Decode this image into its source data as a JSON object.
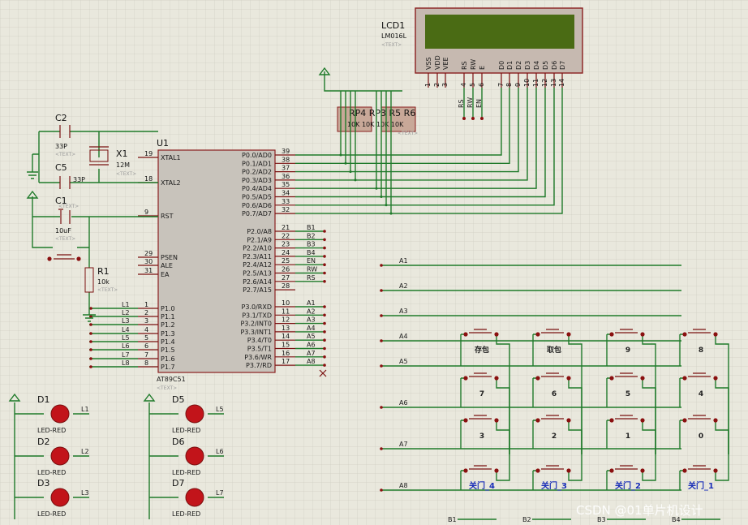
{
  "lcd": {
    "ref": "LCD1",
    "model": "LM016L",
    "text": "<TEXT>",
    "pins": [
      "VSS",
      "VDD",
      "VEE",
      "RS",
      "RW",
      "E",
      "D0",
      "D1",
      "D2",
      "D3",
      "D4",
      "D5",
      "D6",
      "D7"
    ],
    "nums": [
      "1",
      "2",
      "3",
      "4",
      "5",
      "6",
      "7",
      "8",
      "9",
      "10",
      "11",
      "12",
      "13",
      "14"
    ],
    "ctrl": [
      "RS",
      "RW",
      "EN"
    ]
  },
  "mcu": {
    "ref": "U1",
    "model": "AT89C51",
    "text": "<TEXT>",
    "left": [
      {
        "n": "19",
        "l": "XTAL1"
      },
      {
        "n": "18",
        "l": "XTAL2"
      },
      {
        "n": "9",
        "l": "RST"
      },
      {
        "n": "29",
        "l": "PSEN"
      },
      {
        "n": "30",
        "l": "ALE"
      },
      {
        "n": "31",
        "l": "EA"
      },
      {
        "n": "1",
        "l": "P1.0"
      },
      {
        "n": "2",
        "l": "P1.1"
      },
      {
        "n": "3",
        "l": "P1.2"
      },
      {
        "n": "4",
        "l": "P1.3"
      },
      {
        "n": "5",
        "l": "P1.4"
      },
      {
        "n": "6",
        "l": "P1.5"
      },
      {
        "n": "7",
        "l": "P1.6"
      },
      {
        "n": "8",
        "l": "P1.7"
      }
    ],
    "p0": [
      {
        "n": "39",
        "l": "P0.0/AD0"
      },
      {
        "n": "38",
        "l": "P0.1/AD1"
      },
      {
        "n": "37",
        "l": "P0.2/AD2"
      },
      {
        "n": "36",
        "l": "P0.3/AD3"
      },
      {
        "n": "35",
        "l": "P0.4/AD4"
      },
      {
        "n": "34",
        "l": "P0.5/AD5"
      },
      {
        "n": "33",
        "l": "P0.6/AD6"
      },
      {
        "n": "32",
        "l": "P0.7/AD7"
      }
    ],
    "p2": [
      {
        "n": "21",
        "l": "P2.0/A8",
        "net": "B1"
      },
      {
        "n": "22",
        "l": "P2.1/A9",
        "net": "B2"
      },
      {
        "n": "23",
        "l": "P2.2/A10",
        "net": "B3"
      },
      {
        "n": "24",
        "l": "P2.3/A11",
        "net": "B4"
      },
      {
        "n": "25",
        "l": "P2.4/A12",
        "net": "EN"
      },
      {
        "n": "26",
        "l": "P2.5/A13",
        "net": "RW"
      },
      {
        "n": "27",
        "l": "P2.6/A14",
        "net": "RS"
      },
      {
        "n": "28",
        "l": "P2.7/A15",
        "net": ""
      }
    ],
    "p3": [
      {
        "n": "10",
        "l": "P3.0/RXD",
        "net": "A1"
      },
      {
        "n": "11",
        "l": "P3.1/TXD",
        "net": "A2"
      },
      {
        "n": "12",
        "l": "P3.2/INT0",
        "net": "A3"
      },
      {
        "n": "13",
        "l": "P3.3/INT1",
        "net": "A4"
      },
      {
        "n": "14",
        "l": "P3.4/T0",
        "net": "A5"
      },
      {
        "n": "15",
        "l": "P3.5/T1",
        "net": "A6"
      },
      {
        "n": "16",
        "l": "P3.6/WR",
        "net": "A7"
      },
      {
        "n": "17",
        "l": "P3.7/RD",
        "net": "A8"
      }
    ],
    "p1nets": [
      "L1",
      "L2",
      "L3",
      "L4",
      "L5",
      "L6",
      "L7",
      "L8"
    ]
  },
  "parts": {
    "c2": {
      "ref": "C2",
      "val": "33P",
      "text": "<TEXT>"
    },
    "c5": {
      "ref": "C5",
      "val": "33P"
    },
    "x1": {
      "ref": "X1",
      "val": "12M",
      "text": "<TEXT>"
    },
    "c1": {
      "ref": "C1",
      "val": "10uF",
      "text": "<TEXT>",
      "text2": "<TEXT>"
    },
    "r1": {
      "ref": "R1",
      "val": "10k",
      "text": "<TEXT>"
    },
    "rp": {
      "refs": "RP4 RP3 R5 R6",
      "vals": "10K 10K 10K 10K",
      "text": "<TEXT>"
    }
  },
  "keypad": {
    "rows": [
      "A1",
      "A2",
      "A3",
      "A4",
      "A5",
      "A6",
      "A7",
      "A8"
    ],
    "grid": [
      [
        "存包",
        "取包",
        "9",
        "8"
      ],
      [
        "7",
        "6",
        "5",
        "4"
      ],
      [
        "3",
        "2",
        "1",
        "0"
      ],
      [
        "关门_4",
        "关门_3",
        "关门_2",
        "关门_1"
      ]
    ],
    "bottom": [
      "B1",
      "B2",
      "B3",
      "B4"
    ]
  },
  "leds": {
    "model": "LED-RED",
    "items": [
      {
        "ref": "D1",
        "net": "L1"
      },
      {
        "ref": "D2",
        "net": "L2"
      },
      {
        "ref": "D3",
        "net": "L3"
      },
      {
        "ref": "D5",
        "net": "L5"
      },
      {
        "ref": "D6",
        "net": "L6"
      },
      {
        "ref": "D7",
        "net": "L7"
      }
    ]
  },
  "watermark": "CSDN @01单片机设计"
}
